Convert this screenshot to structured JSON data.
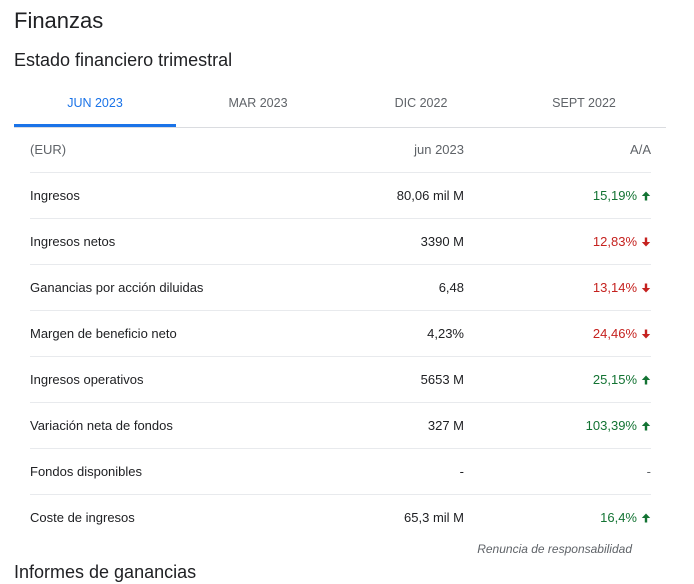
{
  "page": {
    "title": "Finanzas",
    "section_title": "Estado financiero trimestral",
    "next_section_title": "Informes de ganancias",
    "disclaimer": "Renuncia de responsabilidad"
  },
  "colors": {
    "accent": "#1a73e8",
    "up": "#137333",
    "down": "#c5221f"
  },
  "tabs": [
    {
      "label": "JUN 2023",
      "active": true
    },
    {
      "label": "MAR 2023",
      "active": false
    },
    {
      "label": "DIC 2022",
      "active": false
    },
    {
      "label": "SEPT 2022",
      "active": false
    }
  ],
  "table": {
    "header": {
      "currency": "(EUR)",
      "period": "jun 2023",
      "change": "A/A"
    },
    "rows": [
      {
        "label": "Ingresos",
        "value": "80,06 mil M",
        "change": "15,19%",
        "trend": "up",
        "icon": "arrow-up-icon"
      },
      {
        "label": "Ingresos netos",
        "value": "3390 M",
        "change": "12,83%",
        "trend": "down",
        "icon": "arrow-down-icon"
      },
      {
        "label": "Ganancias por acción diluidas",
        "value": "6,48",
        "change": "13,14%",
        "trend": "down",
        "icon": "arrow-down-icon"
      },
      {
        "label": "Margen de beneficio neto",
        "value": "4,23%",
        "change": "24,46%",
        "trend": "down",
        "icon": "arrow-down-icon"
      },
      {
        "label": "Ingresos operativos",
        "value": "5653 M",
        "change": "25,15%",
        "trend": "up",
        "icon": "arrow-up-icon"
      },
      {
        "label": "Variación neta de fondos",
        "value": "327 M",
        "change": "103,39%",
        "trend": "up",
        "icon": "arrow-up-icon"
      },
      {
        "label": "Fondos disponibles",
        "value": "-",
        "change": "-",
        "trend": "none",
        "icon": ""
      },
      {
        "label": "Coste de ingresos",
        "value": "65,3 mil M",
        "change": "16,4%",
        "trend": "up",
        "icon": "arrow-up-icon"
      }
    ]
  }
}
